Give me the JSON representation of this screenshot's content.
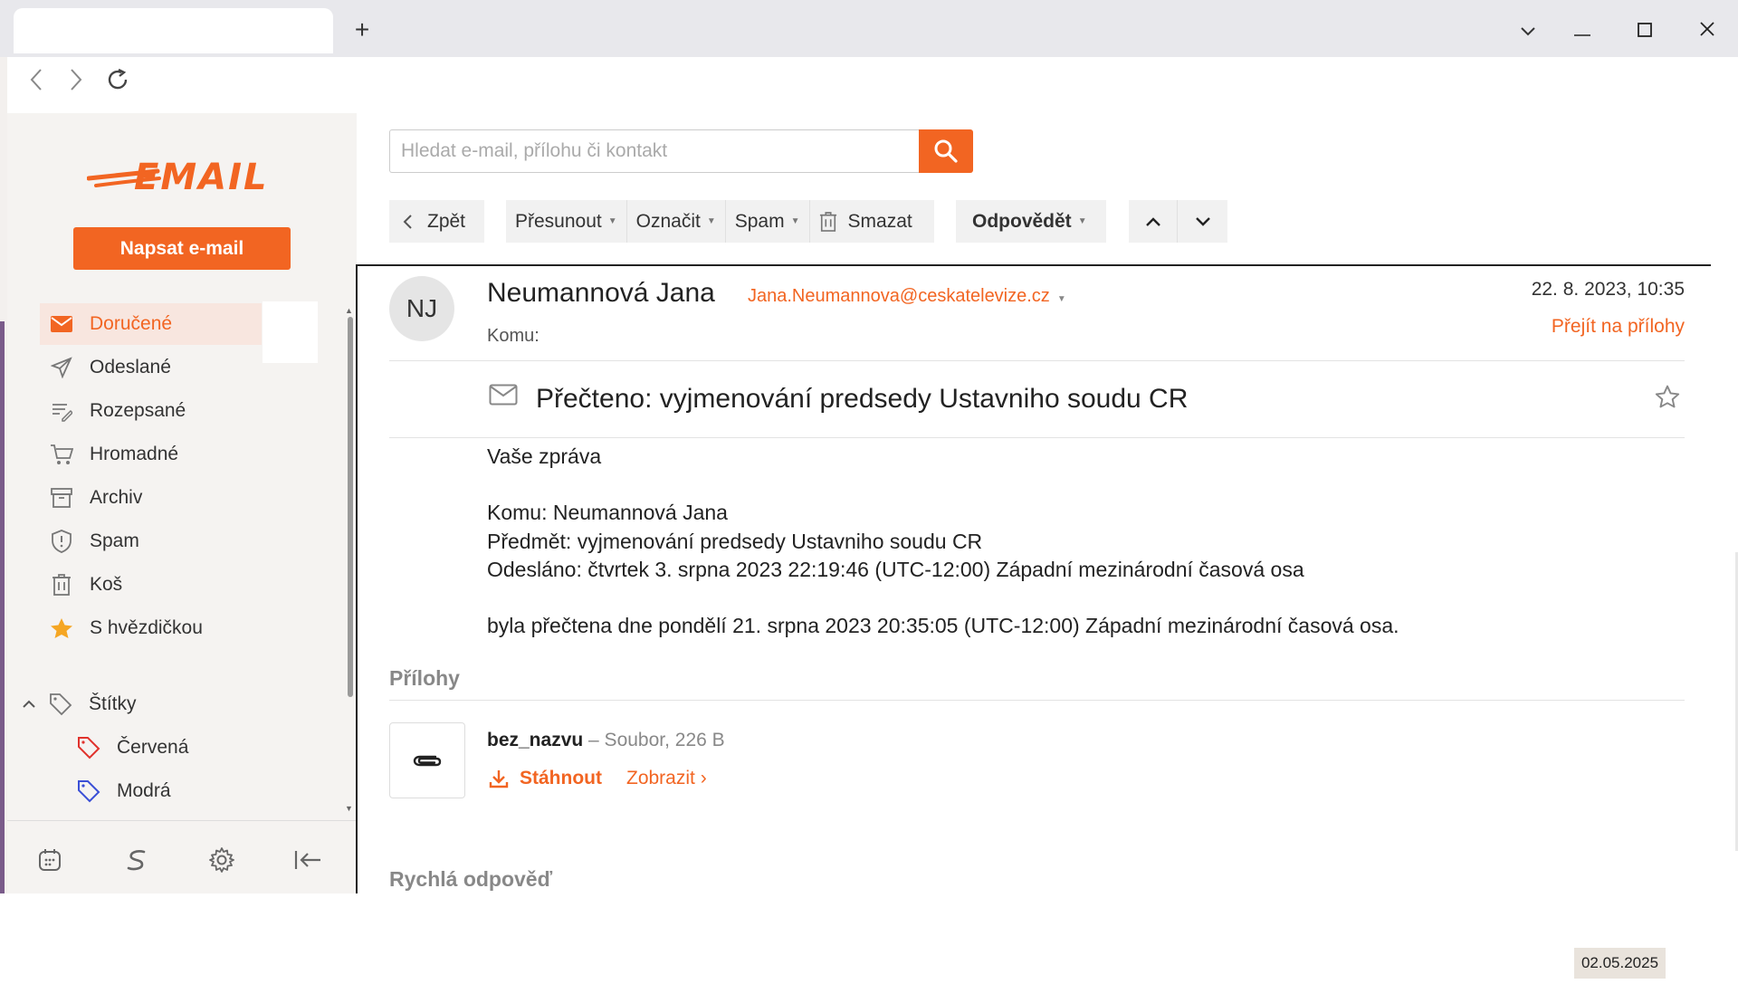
{
  "browser": {
    "new_tab": "+",
    "window_controls": {
      "dropdown": "⌄",
      "minimize": "—",
      "maximize": "☐",
      "close": "✕"
    }
  },
  "app": {
    "logo_text": "EMAIL",
    "compose_label": "Napsat e-mail",
    "accent_color": "#f26522"
  },
  "sidebar": {
    "folders": [
      {
        "label": "Doručené",
        "icon": "inbox-icon",
        "active": true
      },
      {
        "label": "Odeslané",
        "icon": "send-icon"
      },
      {
        "label": "Rozepsané",
        "icon": "drafts-icon"
      },
      {
        "label": "Hromadné",
        "icon": "cart-icon"
      },
      {
        "label": "Archiv",
        "icon": "archive-icon"
      },
      {
        "label": "Spam",
        "icon": "shield-icon"
      },
      {
        "label": "Koš",
        "icon": "trash-icon"
      },
      {
        "label": "S hvězdičkou",
        "icon": "star-icon"
      }
    ],
    "tags_label": "Štítky",
    "tags": [
      {
        "label": "Červená",
        "color": "#e0322c"
      },
      {
        "label": "Modrá",
        "color": "#3a4fd6"
      }
    ]
  },
  "search": {
    "placeholder": "Hledat e-mail, přílohu či kontakt"
  },
  "toolbar": {
    "back": "Zpět",
    "move": "Přesunout",
    "mark": "Označit",
    "spam": "Spam",
    "delete": "Smazat",
    "reply": "Odpovědět"
  },
  "message": {
    "avatar_initials": "NJ",
    "sender_name": "Neumannová Jana",
    "sender_email": "Jana.Neumannova@ceskatelevize.cz",
    "to_label": "Komu:",
    "date": "22. 8. 2023, 10:35",
    "goto_attachments": "Přejít na přílohy",
    "subject": "Přečteno: vyjmenování predsedy Ustavniho soudu CR",
    "body": [
      "Vaše zpráva",
      "Komu: Neumannová Jana",
      "Předmět: vyjmenování predsedy Ustavniho soudu CR",
      "Odesláno: čtvrtek 3. srpna 2023 22:19:46 (UTC-12:00) Západní mezinárodní časová osa",
      "byla přečtena dne pondělí 21. srpna 2023 20:35:05 (UTC-12:00) Západní mezinárodní časová osa."
    ]
  },
  "attachments": {
    "heading": "Přílohy",
    "items": [
      {
        "name": "bez_nazvu",
        "meta": "– Soubor, 226 B",
        "download": "Stáhnout",
        "view": "Zobrazit ›"
      }
    ]
  },
  "quick_reply": "Rychlá odpověď",
  "taskbar_date": "02.05.2025"
}
